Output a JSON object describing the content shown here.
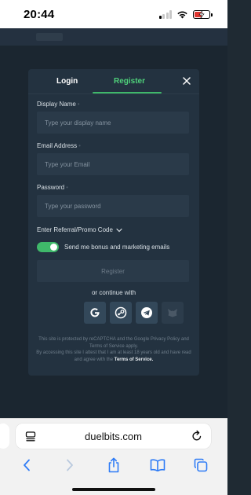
{
  "status_bar": {
    "time": "20:44"
  },
  "modal": {
    "tabs": {
      "login": "Login",
      "register": "Register"
    },
    "fields": {
      "display_name": {
        "label": "Display Name",
        "required_mark": "•",
        "placeholder": "Type your display name"
      },
      "email": {
        "label": "Email Address",
        "required_mark": "•",
        "placeholder": "Type your Email"
      },
      "password": {
        "label": "Password",
        "required_mark": "•",
        "placeholder": "Type your password"
      }
    },
    "promo_label": "Enter Referral/Promo Code",
    "marketing_toggle": {
      "label": "Send me bonus and marketing emails",
      "checked": true
    },
    "register_button": "Register",
    "continue_with": "or continue with",
    "social": [
      "google-icon",
      "steam-icon",
      "telegram-icon",
      "metamask-icon"
    ],
    "legal": {
      "line1": "This site is protected by reCAPTCHA and the Google Privacy Policy and Terms of Service apply.",
      "line2": "By accessing this site I attest that I am at least 18 years old and have read and agree with the",
      "terms_link": "Terms of Service."
    }
  },
  "browser": {
    "url": "duelbits.com"
  },
  "colors": {
    "accent": "#3fb86a",
    "modal_bg": "#233240",
    "input_bg": "#2a3a49"
  }
}
